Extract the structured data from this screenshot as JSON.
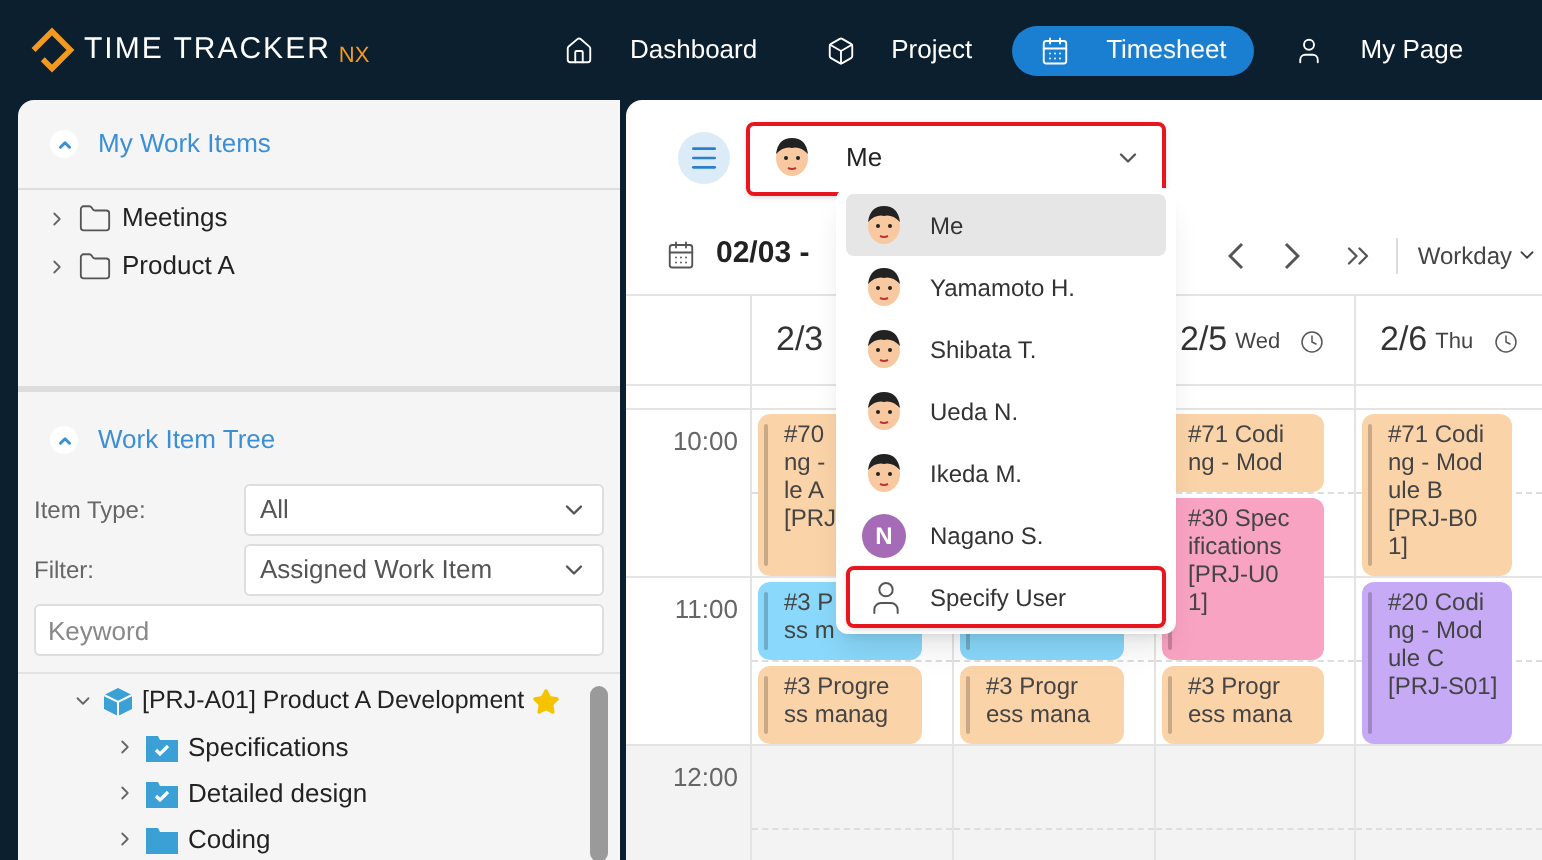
{
  "app": {
    "logo_text": "TIME TRACKER",
    "logo_suffix": "NX"
  },
  "nav": [
    {
      "label": "Dashboard",
      "selected": false
    },
    {
      "label": "Project",
      "selected": false
    },
    {
      "label": "Timesheet",
      "selected": true
    },
    {
      "label": "My Page",
      "selected": false
    }
  ],
  "sidebar": {
    "my_work_items": {
      "title": "My Work Items",
      "expanded": true,
      "items": [
        {
          "label": "Meetings",
          "expanded": false
        },
        {
          "label": "Product A",
          "expanded": false
        }
      ]
    },
    "work_item_tree": {
      "title": "Work Item Tree",
      "expanded": true,
      "item_type": {
        "label": "Item Type:",
        "value": "All"
      },
      "filter": {
        "label": "Filter:",
        "value": "Assigned Work Item"
      },
      "keyword": {
        "placeholder": "Keyword"
      },
      "tree": [
        {
          "label": "[PRJ-A01] Product A Development",
          "kind": "project",
          "starred": true,
          "expanded": true,
          "children": [
            {
              "label": "Specifications",
              "kind": "task-folder",
              "expanded": false
            },
            {
              "label": "Detailed design",
              "kind": "task-folder",
              "expanded": false
            },
            {
              "label": "Coding",
              "kind": "folder",
              "expanded": false
            }
          ]
        }
      ]
    }
  },
  "user_select": {
    "value": "Me",
    "highlighted": true,
    "options": [
      {
        "label": "Me",
        "kind": "avatar",
        "selected": true,
        "highlighted": false
      },
      {
        "label": "Yamamoto H.",
        "kind": "avatar",
        "selected": false,
        "highlighted": false
      },
      {
        "label": "Shibata T.",
        "kind": "avatar",
        "selected": false,
        "highlighted": false
      },
      {
        "label": "Ueda N.",
        "kind": "avatar",
        "selected": false,
        "highlighted": false
      },
      {
        "label": "Ikeda M.",
        "kind": "avatar",
        "selected": false,
        "highlighted": false
      },
      {
        "label": "Nagano S.",
        "kind": "initial",
        "initial": "N",
        "color": "#a56bb6",
        "selected": false,
        "highlighted": false
      },
      {
        "label": "Specify User",
        "kind": "specify",
        "selected": false,
        "highlighted": true
      }
    ]
  },
  "toolbar": {
    "date_range": "02/03 -",
    "view": "Workday"
  },
  "calendar": {
    "times": [
      "10:00",
      "11:00",
      "12:00"
    ],
    "days": [
      {
        "date": "2/3",
        "blocks": [
          {
            "kind": "hour",
            "color": "#fbd3a8",
            "lines": [
              "#70",
              "ng -",
              "le A",
              "[PRJ"
            ]
          },
          {
            "kind": "half",
            "color": "#8ad8fb",
            "lines": [
              "#3 P",
              "ss m"
            ]
          },
          {
            "kind": "half",
            "color": "#fbd3a8",
            "lines": [
              "#3 Progre",
              "ss manag"
            ]
          }
        ]
      },
      {
        "blocks": [
          {
            "kind": "gap-hour"
          },
          {
            "kind": "half",
            "color": "#8ad8fb"
          },
          {
            "kind": "half",
            "color": "#fbd3a8",
            "lines": [
              "#3 Progr",
              "ess mana"
            ]
          }
        ]
      },
      {
        "date": "2/5",
        "weekday": "Wed",
        "blocks": [
          {
            "kind": "half",
            "color": "#fbd3a8",
            "lines": [
              "#71 Codi",
              "ng - Mod"
            ]
          },
          {
            "kind": "hour",
            "color": "#f9a3c2",
            "lines": [
              "#30 Spec",
              "ifications",
              "[PRJ-U0",
              "1]"
            ]
          },
          {
            "kind": "half",
            "color": "#fbd3a8",
            "lines": [
              "#3 Progr",
              "ess mana"
            ]
          }
        ]
      },
      {
        "date": "2/6",
        "weekday": "Thu",
        "blocks": [
          {
            "kind": "hour",
            "color": "#fbd3a8",
            "lines": [
              "#71 Codi",
              "ng - Mod",
              "ule B",
              "[PRJ-B0",
              "1]"
            ]
          },
          {
            "kind": "hour",
            "color": "#c6aaf5",
            "lines": [
              "#20 Codi",
              "ng - Mod",
              "ule C",
              "[PRJ-S01]"
            ]
          }
        ]
      }
    ]
  }
}
